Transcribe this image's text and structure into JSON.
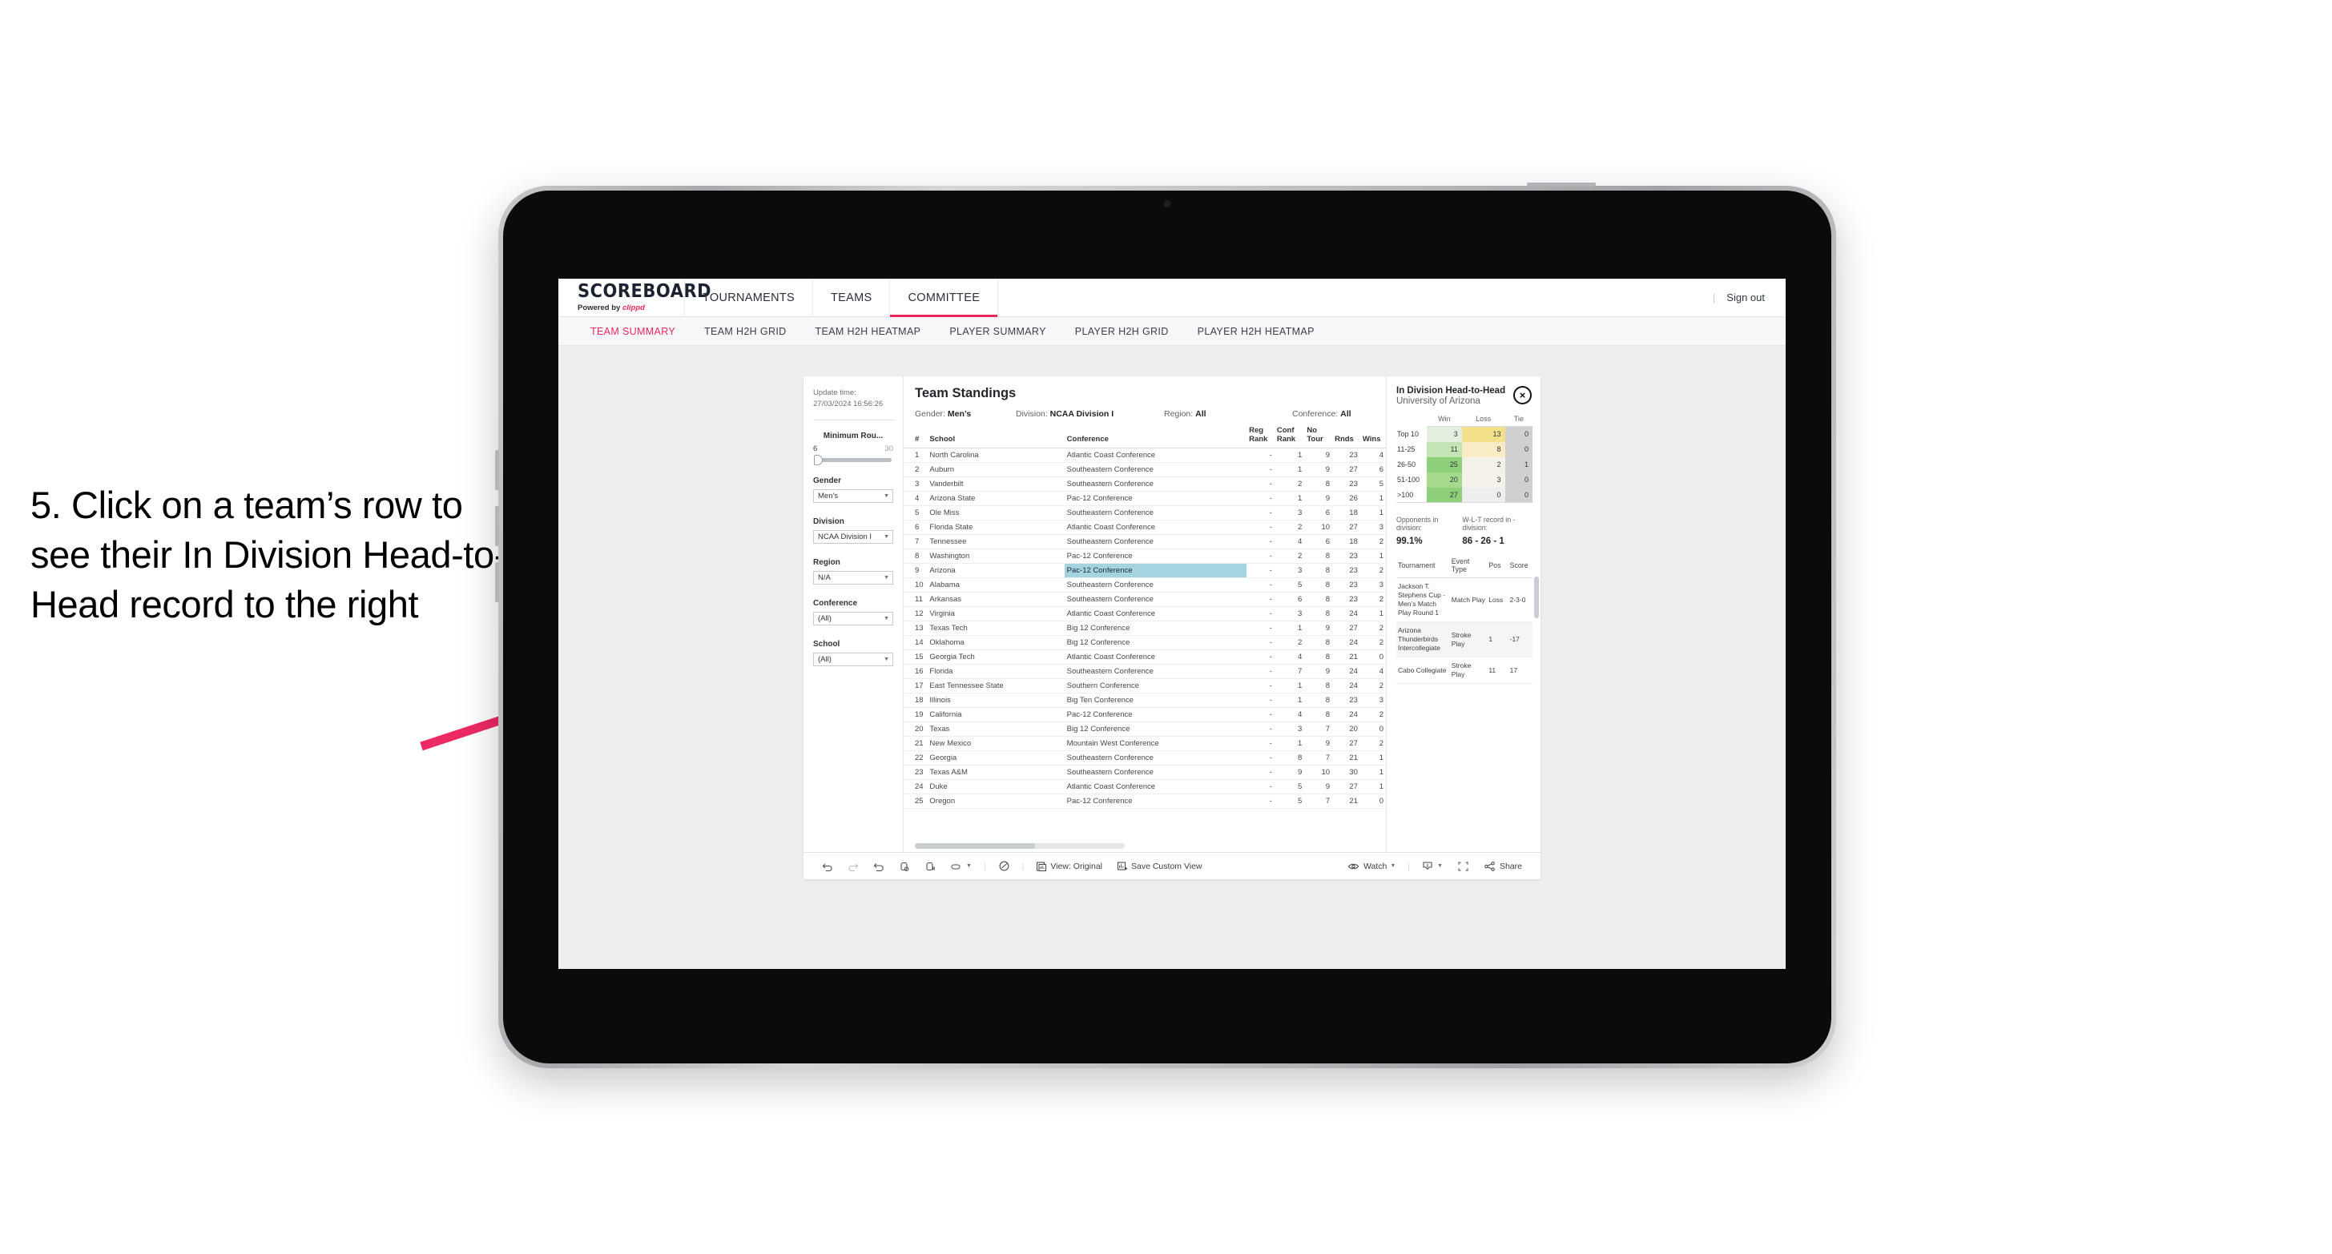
{
  "caption": {
    "text": "5. Click on a team’s row to see their In Division Head-to-Head record to the right"
  },
  "topnav": {
    "brand_title": "SCOREBOARD",
    "brand_sub_prefix": "Powered by ",
    "brand_sub_name": "clippd",
    "items": [
      {
        "label": "TOURNAMENTS",
        "active": false
      },
      {
        "label": "TEAMS",
        "active": false
      },
      {
        "label": "COMMITTEE",
        "active": true
      }
    ],
    "divider": "|",
    "signout": "Sign out"
  },
  "subnav": {
    "items": [
      {
        "label": "TEAM SUMMARY",
        "active": true
      },
      {
        "label": "TEAM H2H GRID",
        "active": false
      },
      {
        "label": "TEAM H2H HEATMAP",
        "active": false
      },
      {
        "label": "PLAYER SUMMARY",
        "active": false
      },
      {
        "label": "PLAYER H2H GRID",
        "active": false
      },
      {
        "label": "PLAYER H2H HEATMAP",
        "active": false
      }
    ]
  },
  "filters": {
    "update_label": "Update time:",
    "update_value": "27/03/2024 16:56:26",
    "min_rounds_label": "Minimum Rou...",
    "min_rounds_min": "6",
    "min_rounds_max": "30",
    "gender_label": "Gender",
    "gender_value": "Men’s",
    "division_label": "Division",
    "division_value": "NCAA Division I",
    "region_label": "Region",
    "region_value": "N/A",
    "conference_label": "Conference",
    "conference_value": "(All)",
    "school_label": "School",
    "school_value": "(All)"
  },
  "standings": {
    "title": "Team Standings",
    "gender_label": "Gender:",
    "gender_value": "Men’s",
    "division_label": "Division:",
    "division_value": "NCAA Division I",
    "region_label": "Region:",
    "region_value": "All",
    "conference_label": "Conference:",
    "conference_value": "All",
    "columns": [
      "#",
      "School",
      "Conference",
      "Reg Rank",
      "Conf Rank",
      "No Tour",
      "Rnds",
      "Wins"
    ],
    "rows": [
      {
        "num": "1",
        "school": "North Carolina",
        "conf": "Atlantic Coast Conference",
        "reg": "-",
        "confrank": "1",
        "notour": "9",
        "rnds": "23",
        "wins": "4",
        "selected": false
      },
      {
        "num": "2",
        "school": "Auburn",
        "conf": "Southeastern Conference",
        "reg": "-",
        "confrank": "1",
        "notour": "9",
        "rnds": "27",
        "wins": "6",
        "selected": false
      },
      {
        "num": "3",
        "school": "Vanderbilt",
        "conf": "Southeastern Conference",
        "reg": "-",
        "confrank": "2",
        "notour": "8",
        "rnds": "23",
        "wins": "5",
        "selected": false
      },
      {
        "num": "4",
        "school": "Arizona State",
        "conf": "Pac-12 Conference",
        "reg": "-",
        "confrank": "1",
        "notour": "9",
        "rnds": "26",
        "wins": "1",
        "selected": false
      },
      {
        "num": "5",
        "school": "Ole Miss",
        "conf": "Southeastern Conference",
        "reg": "-",
        "confrank": "3",
        "notour": "6",
        "rnds": "18",
        "wins": "1",
        "selected": false
      },
      {
        "num": "6",
        "school": "Florida State",
        "conf": "Atlantic Coast Conference",
        "reg": "-",
        "confrank": "2",
        "notour": "10",
        "rnds": "27",
        "wins": "3",
        "selected": false
      },
      {
        "num": "7",
        "school": "Tennessee",
        "conf": "Southeastern Conference",
        "reg": "-",
        "confrank": "4",
        "notour": "6",
        "rnds": "18",
        "wins": "2",
        "selected": false
      },
      {
        "num": "8",
        "school": "Washington",
        "conf": "Pac-12 Conference",
        "reg": "-",
        "confrank": "2",
        "notour": "8",
        "rnds": "23",
        "wins": "1",
        "selected": false
      },
      {
        "num": "9",
        "school": "Arizona",
        "conf": "Pac-12 Conference",
        "reg": "-",
        "confrank": "3",
        "notour": "8",
        "rnds": "23",
        "wins": "2",
        "selected": true
      },
      {
        "num": "10",
        "school": "Alabama",
        "conf": "Southeastern Conference",
        "reg": "-",
        "confrank": "5",
        "notour": "8",
        "rnds": "23",
        "wins": "3",
        "selected": false
      },
      {
        "num": "11",
        "school": "Arkansas",
        "conf": "Southeastern Conference",
        "reg": "-",
        "confrank": "6",
        "notour": "8",
        "rnds": "23",
        "wins": "2",
        "selected": false
      },
      {
        "num": "12",
        "school": "Virginia",
        "conf": "Atlantic Coast Conference",
        "reg": "-",
        "confrank": "3",
        "notour": "8",
        "rnds": "24",
        "wins": "1",
        "selected": false
      },
      {
        "num": "13",
        "school": "Texas Tech",
        "conf": "Big 12 Conference",
        "reg": "-",
        "confrank": "1",
        "notour": "9",
        "rnds": "27",
        "wins": "2",
        "selected": false
      },
      {
        "num": "14",
        "school": "Oklahoma",
        "conf": "Big 12 Conference",
        "reg": "-",
        "confrank": "2",
        "notour": "8",
        "rnds": "24",
        "wins": "2",
        "selected": false
      },
      {
        "num": "15",
        "school": "Georgia Tech",
        "conf": "Atlantic Coast Conference",
        "reg": "-",
        "confrank": "4",
        "notour": "8",
        "rnds": "21",
        "wins": "0",
        "selected": false
      },
      {
        "num": "16",
        "school": "Florida",
        "conf": "Southeastern Conference",
        "reg": "-",
        "confrank": "7",
        "notour": "9",
        "rnds": "24",
        "wins": "4",
        "selected": false
      },
      {
        "num": "17",
        "school": "East Tennessee State",
        "conf": "Southern Conference",
        "reg": "-",
        "confrank": "1",
        "notour": "8",
        "rnds": "24",
        "wins": "2",
        "selected": false
      },
      {
        "num": "18",
        "school": "Illinois",
        "conf": "Big Ten Conference",
        "reg": "-",
        "confrank": "1",
        "notour": "8",
        "rnds": "23",
        "wins": "3",
        "selected": false
      },
      {
        "num": "19",
        "school": "California",
        "conf": "Pac-12 Conference",
        "reg": "-",
        "confrank": "4",
        "notour": "8",
        "rnds": "24",
        "wins": "2",
        "selected": false
      },
      {
        "num": "20",
        "school": "Texas",
        "conf": "Big 12 Conference",
        "reg": "-",
        "confrank": "3",
        "notour": "7",
        "rnds": "20",
        "wins": "0",
        "selected": false
      },
      {
        "num": "21",
        "school": "New Mexico",
        "conf": "Mountain West Conference",
        "reg": "-",
        "confrank": "1",
        "notour": "9",
        "rnds": "27",
        "wins": "2",
        "selected": false
      },
      {
        "num": "22",
        "school": "Georgia",
        "conf": "Southeastern Conference",
        "reg": "-",
        "confrank": "8",
        "notour": "7",
        "rnds": "21",
        "wins": "1",
        "selected": false
      },
      {
        "num": "23",
        "school": "Texas A&M",
        "conf": "Southeastern Conference",
        "reg": "-",
        "confrank": "9",
        "notour": "10",
        "rnds": "30",
        "wins": "1",
        "selected": false
      },
      {
        "num": "24",
        "school": "Duke",
        "conf": "Atlantic Coast Conference",
        "reg": "-",
        "confrank": "5",
        "notour": "9",
        "rnds": "27",
        "wins": "1",
        "selected": false
      },
      {
        "num": "25",
        "school": "Oregon",
        "conf": "Pac-12 Conference",
        "reg": "-",
        "confrank": "5",
        "notour": "7",
        "rnds": "21",
        "wins": "0",
        "selected": false
      }
    ]
  },
  "h2h": {
    "title": "In Division Head-to-Head",
    "subtitle": "University of Arizona",
    "close_icon": "×",
    "columns": [
      "",
      "Win",
      "Loss",
      "Tie"
    ],
    "rows": [
      {
        "label": "Top 10",
        "win": "3",
        "loss": "13",
        "tie": "0",
        "win_color": "#e4efe0",
        "loss_color": "#f2e08a",
        "tie_color": "#d0d0d0"
      },
      {
        "label": "11-25",
        "win": "11",
        "loss": "8",
        "tie": "0",
        "win_color": "#c5e4b5",
        "loss_color": "#f7ecc3",
        "tie_color": "#d0d0d0"
      },
      {
        "label": "26-50",
        "win": "25",
        "loss": "2",
        "tie": "1",
        "win_color": "#8ed07a",
        "loss_color": "#f3f1e8",
        "tie_color": "#d0d0d0"
      },
      {
        "label": "51-100",
        "win": "20",
        "loss": "3",
        "tie": "0",
        "win_color": "#a5da8e",
        "loss_color": "#f4f2eb",
        "tie_color": "#d0d0d0"
      },
      {
        "label": ">100",
        "win": "27",
        "loss": "0",
        "tie": "0",
        "win_color": "#8ed07a",
        "loss_color": "#eeeeee",
        "tie_color": "#d0d0d0"
      }
    ],
    "stat_opponents_label": "Opponents in division:",
    "stat_opponents_value": "99.1%",
    "stat_record_label": "W-L-T record in -division:",
    "stat_record_value": "86 - 26 - 1",
    "events_columns": [
      "Tournament",
      "Event Type",
      "Pos",
      "Score"
    ],
    "events": [
      {
        "tournament": "Jackson T. Stephens Cup - Men’s Match Play Round 1",
        "type": "Match Play",
        "pos": "Loss",
        "score": "2-3-0"
      },
      {
        "tournament": "Arizona Thunderbirds Intercollegiate",
        "type": "Stroke Play",
        "pos": "1",
        "score": "-17"
      },
      {
        "tournament": "Cabo Collegiate",
        "type": "Stroke Play",
        "pos": "11",
        "score": "17"
      }
    ]
  },
  "toolbar": {
    "undo": "undo-icon",
    "redo": "redo-icon",
    "revert": "revert-icon",
    "refresh": "refresh-icon",
    "pause": "pause-icon",
    "view_original_label": "View: Original",
    "save_custom_view_label": "Save Custom View",
    "watch_label": "Watch",
    "share_label": "Share",
    "sep": "|"
  },
  "colors": {
    "accent": "#e8285a",
    "selected_row": "#a4d4e0",
    "screen_bg": "#edeef0"
  }
}
